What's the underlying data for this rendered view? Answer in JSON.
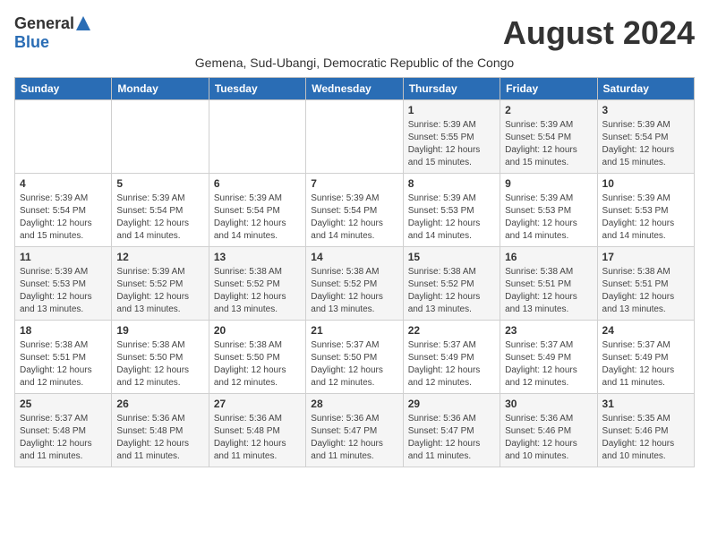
{
  "logo": {
    "general": "General",
    "blue": "Blue"
  },
  "title": "August 2024",
  "subtitle": "Gemena, Sud-Ubangi, Democratic Republic of the Congo",
  "headers": [
    "Sunday",
    "Monday",
    "Tuesday",
    "Wednesday",
    "Thursday",
    "Friday",
    "Saturday"
  ],
  "weeks": [
    [
      {
        "day": "",
        "info": ""
      },
      {
        "day": "",
        "info": ""
      },
      {
        "day": "",
        "info": ""
      },
      {
        "day": "",
        "info": ""
      },
      {
        "day": "1",
        "info": "Sunrise: 5:39 AM\nSunset: 5:55 PM\nDaylight: 12 hours\nand 15 minutes."
      },
      {
        "day": "2",
        "info": "Sunrise: 5:39 AM\nSunset: 5:54 PM\nDaylight: 12 hours\nand 15 minutes."
      },
      {
        "day": "3",
        "info": "Sunrise: 5:39 AM\nSunset: 5:54 PM\nDaylight: 12 hours\nand 15 minutes."
      }
    ],
    [
      {
        "day": "4",
        "info": "Sunrise: 5:39 AM\nSunset: 5:54 PM\nDaylight: 12 hours\nand 15 minutes."
      },
      {
        "day": "5",
        "info": "Sunrise: 5:39 AM\nSunset: 5:54 PM\nDaylight: 12 hours\nand 14 minutes."
      },
      {
        "day": "6",
        "info": "Sunrise: 5:39 AM\nSunset: 5:54 PM\nDaylight: 12 hours\nand 14 minutes."
      },
      {
        "day": "7",
        "info": "Sunrise: 5:39 AM\nSunset: 5:54 PM\nDaylight: 12 hours\nand 14 minutes."
      },
      {
        "day": "8",
        "info": "Sunrise: 5:39 AM\nSunset: 5:53 PM\nDaylight: 12 hours\nand 14 minutes."
      },
      {
        "day": "9",
        "info": "Sunrise: 5:39 AM\nSunset: 5:53 PM\nDaylight: 12 hours\nand 14 minutes."
      },
      {
        "day": "10",
        "info": "Sunrise: 5:39 AM\nSunset: 5:53 PM\nDaylight: 12 hours\nand 14 minutes."
      }
    ],
    [
      {
        "day": "11",
        "info": "Sunrise: 5:39 AM\nSunset: 5:53 PM\nDaylight: 12 hours\nand 13 minutes."
      },
      {
        "day": "12",
        "info": "Sunrise: 5:39 AM\nSunset: 5:52 PM\nDaylight: 12 hours\nand 13 minutes."
      },
      {
        "day": "13",
        "info": "Sunrise: 5:38 AM\nSunset: 5:52 PM\nDaylight: 12 hours\nand 13 minutes."
      },
      {
        "day": "14",
        "info": "Sunrise: 5:38 AM\nSunset: 5:52 PM\nDaylight: 12 hours\nand 13 minutes."
      },
      {
        "day": "15",
        "info": "Sunrise: 5:38 AM\nSunset: 5:52 PM\nDaylight: 12 hours\nand 13 minutes."
      },
      {
        "day": "16",
        "info": "Sunrise: 5:38 AM\nSunset: 5:51 PM\nDaylight: 12 hours\nand 13 minutes."
      },
      {
        "day": "17",
        "info": "Sunrise: 5:38 AM\nSunset: 5:51 PM\nDaylight: 12 hours\nand 13 minutes."
      }
    ],
    [
      {
        "day": "18",
        "info": "Sunrise: 5:38 AM\nSunset: 5:51 PM\nDaylight: 12 hours\nand 12 minutes."
      },
      {
        "day": "19",
        "info": "Sunrise: 5:38 AM\nSunset: 5:50 PM\nDaylight: 12 hours\nand 12 minutes."
      },
      {
        "day": "20",
        "info": "Sunrise: 5:38 AM\nSunset: 5:50 PM\nDaylight: 12 hours\nand 12 minutes."
      },
      {
        "day": "21",
        "info": "Sunrise: 5:37 AM\nSunset: 5:50 PM\nDaylight: 12 hours\nand 12 minutes."
      },
      {
        "day": "22",
        "info": "Sunrise: 5:37 AM\nSunset: 5:49 PM\nDaylight: 12 hours\nand 12 minutes."
      },
      {
        "day": "23",
        "info": "Sunrise: 5:37 AM\nSunset: 5:49 PM\nDaylight: 12 hours\nand 12 minutes."
      },
      {
        "day": "24",
        "info": "Sunrise: 5:37 AM\nSunset: 5:49 PM\nDaylight: 12 hours\nand 11 minutes."
      }
    ],
    [
      {
        "day": "25",
        "info": "Sunrise: 5:37 AM\nSunset: 5:48 PM\nDaylight: 12 hours\nand 11 minutes."
      },
      {
        "day": "26",
        "info": "Sunrise: 5:36 AM\nSunset: 5:48 PM\nDaylight: 12 hours\nand 11 minutes."
      },
      {
        "day": "27",
        "info": "Sunrise: 5:36 AM\nSunset: 5:48 PM\nDaylight: 12 hours\nand 11 minutes."
      },
      {
        "day": "28",
        "info": "Sunrise: 5:36 AM\nSunset: 5:47 PM\nDaylight: 12 hours\nand 11 minutes."
      },
      {
        "day": "29",
        "info": "Sunrise: 5:36 AM\nSunset: 5:47 PM\nDaylight: 12 hours\nand 11 minutes."
      },
      {
        "day": "30",
        "info": "Sunrise: 5:36 AM\nSunset: 5:46 PM\nDaylight: 12 hours\nand 10 minutes."
      },
      {
        "day": "31",
        "info": "Sunrise: 5:35 AM\nSunset: 5:46 PM\nDaylight: 12 hours\nand 10 minutes."
      }
    ]
  ]
}
